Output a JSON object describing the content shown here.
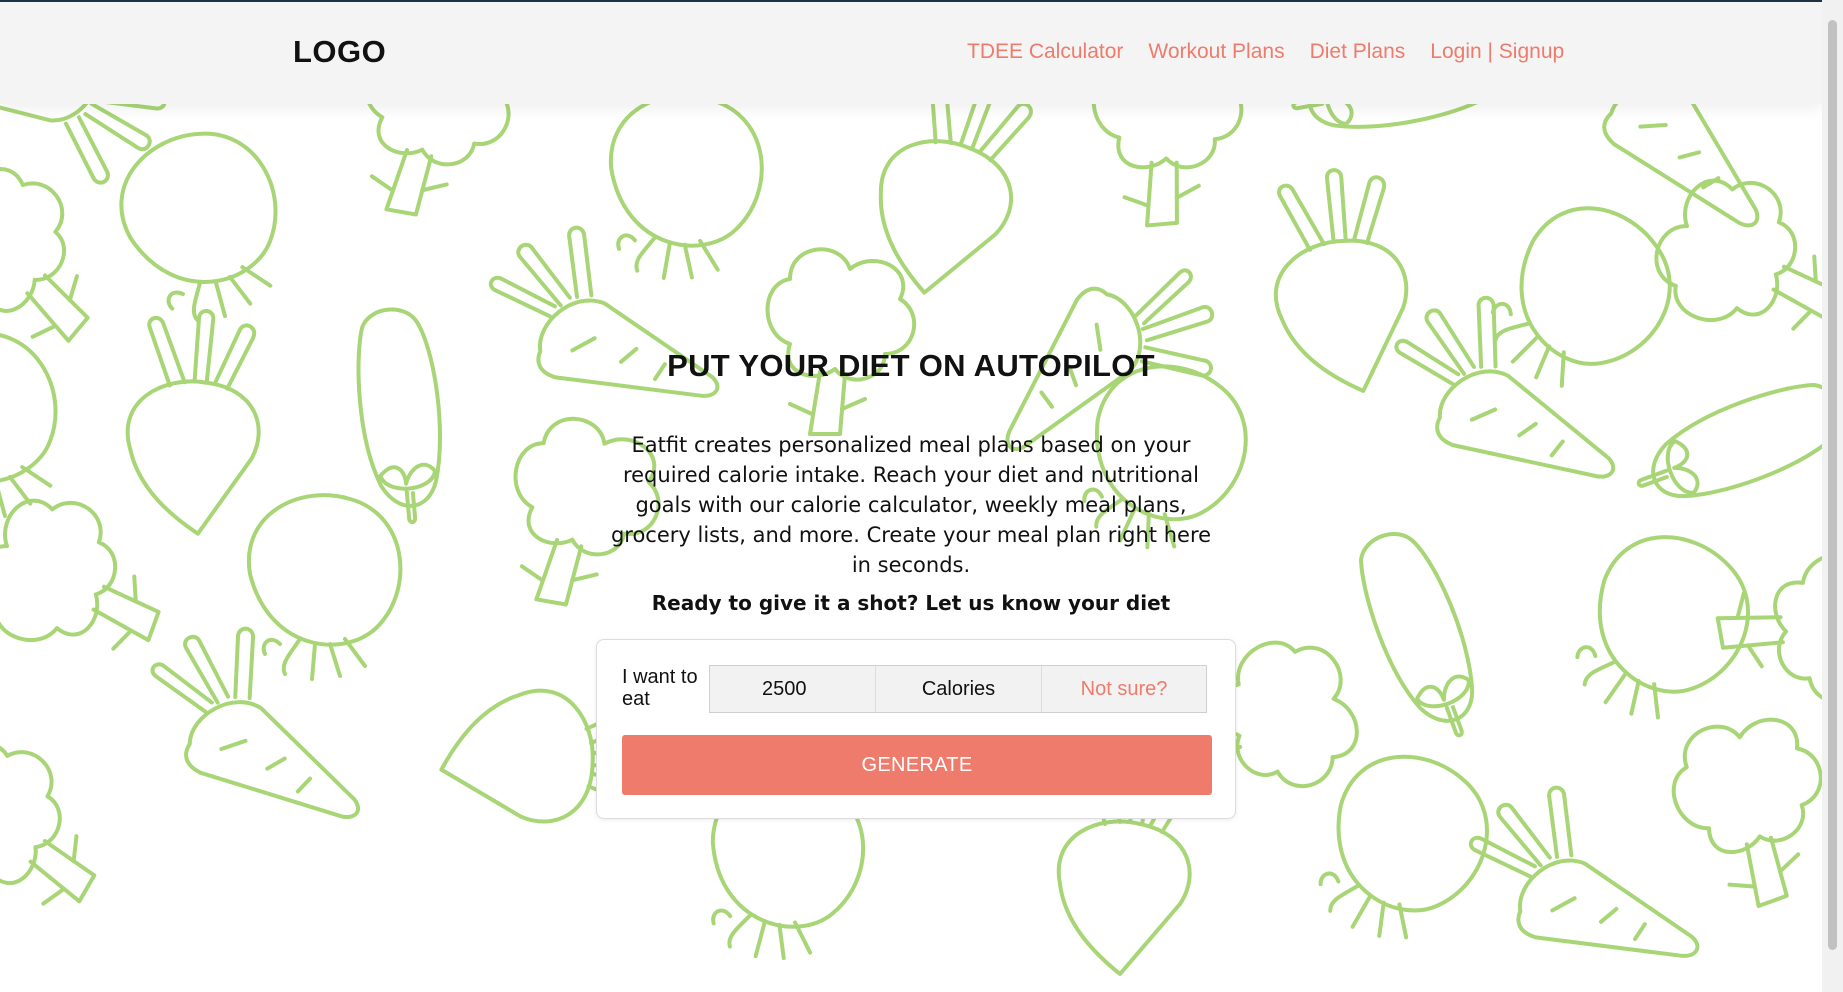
{
  "header": {
    "logo": "LOGO",
    "nav": [
      {
        "label": "TDEE Calculator"
      },
      {
        "label": "Workout Plans"
      },
      {
        "label": "Diet Plans"
      },
      {
        "label": "Login | Signup"
      }
    ]
  },
  "hero": {
    "title": "PUT YOUR DIET ON AUTOPILOT",
    "description": "Eatfit creates personalized meal plans based on your required calorie intake. Reach your diet and nutritional goals with our calorie calculator, weekly meal plans, grocery lists, and more. Create your meal plan right here in seconds.",
    "cta": "Ready to give it a shot? Let us know your diet"
  },
  "form": {
    "label": "I want to eat",
    "calories_value": "2500",
    "unit": "Calories",
    "not_sure": "Not sure?",
    "generate": "GENERATE"
  },
  "colors": {
    "accent": "#ee7b6b",
    "pattern": "#a8d576",
    "header_bg": "#f4f4f4"
  },
  "icons": [
    "broccoli-icon",
    "carrot-icon",
    "eggplant-icon",
    "tomato-icon",
    "beet-icon"
  ]
}
